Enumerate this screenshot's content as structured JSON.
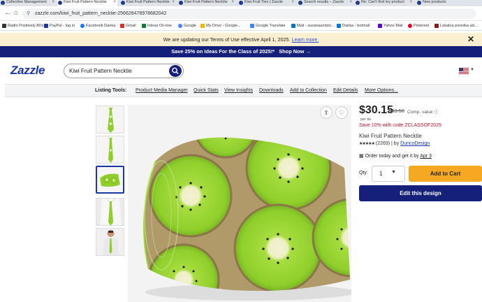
{
  "browser": {
    "tabs": [
      {
        "label": "Collection Management"
      },
      {
        "label": "Kiwi Fruit Pattern Necktie"
      },
      {
        "label": "Kiwi Fruit Pattern Necktie"
      },
      {
        "label": "Kiwi Fruit Pattern Necktie"
      },
      {
        "label": "Kiwi Fruit Ties | Zazzle"
      },
      {
        "label": "Search results – Zazzle"
      },
      {
        "label": "Re: Can't find my product"
      },
      {
        "label": "New products"
      }
    ],
    "url": "zazzle.com/kiwi_fruit_pattern_necktie-256628478978682042",
    "bookmarks": [
      {
        "label": "Radio Positively 80's",
        "color": "#333333"
      },
      {
        "label": "PayPal - log in",
        "color": "#1a36a8"
      },
      {
        "label": "Facebook Danka",
        "color": "#1877f2"
      },
      {
        "label": "Gmail",
        "color": "#d93025"
      },
      {
        "label": "Intesa On-line",
        "color": "#0a7a3a"
      },
      {
        "label": "Google",
        "color": "#4285f4"
      },
      {
        "label": "My Drive - Google...",
        "color": "#f4b400"
      },
      {
        "label": "Google Translate",
        "color": "#4285f4"
      },
      {
        "label": "Mail - suzanaandzic...",
        "color": "#0078d4"
      },
      {
        "label": "Danka - hotmail",
        "color": "#0078d4"
      },
      {
        "label": "Yahoo Mail",
        "color": "#6001d2"
      },
      {
        "label": "Pinterest",
        "color": "#e60023"
      },
      {
        "label": "Lokalna poreska ad...",
        "color": "#8b1a1a"
      }
    ]
  },
  "banner": {
    "terms_text": "We are updating our Terms of Use effective April 1, 2025.",
    "terms_link": "Learn more.",
    "close": "✕",
    "promo": "Save 25% on Ideas For the Class of 2025!*",
    "promo_cta": "Shop Now →"
  },
  "header": {
    "logo": "Zazzle",
    "search_value": "Kiwi Fruit Pattern Necktie"
  },
  "listing_tools": {
    "label": "Listing Tools:",
    "links": [
      "Product Media Manager",
      "Quick Stats",
      "View Insights",
      "Downloads",
      "Add to Collection",
      "Edit Details",
      "More Options..."
    ]
  },
  "product": {
    "price": "$30.15",
    "old_price": "$33.50",
    "comp_value": "Comp. value",
    "unit": "per tie",
    "promo_code": "Save 10% with code ZCLASSOF2025",
    "title": "Kiwi Fruit Pattern Necktie",
    "stars": "★★★★★",
    "review_count": "(2269)",
    "by": "| by",
    "designer": "DuncoDesign",
    "delivery_text": "Order today and get it by",
    "delivery_date": "Apr 3",
    "qty_label": "Qty:",
    "qty_value": "1",
    "add_to_cart": "Add to Cart",
    "edit_design": "Edit this design"
  },
  "colors": {
    "brand_navy": "#14207a",
    "logo_blue": "#1a36a8",
    "cart_orange": "#f7a823",
    "promo_red": "#c8102e",
    "kiwi_green": "#8fcf2c"
  }
}
